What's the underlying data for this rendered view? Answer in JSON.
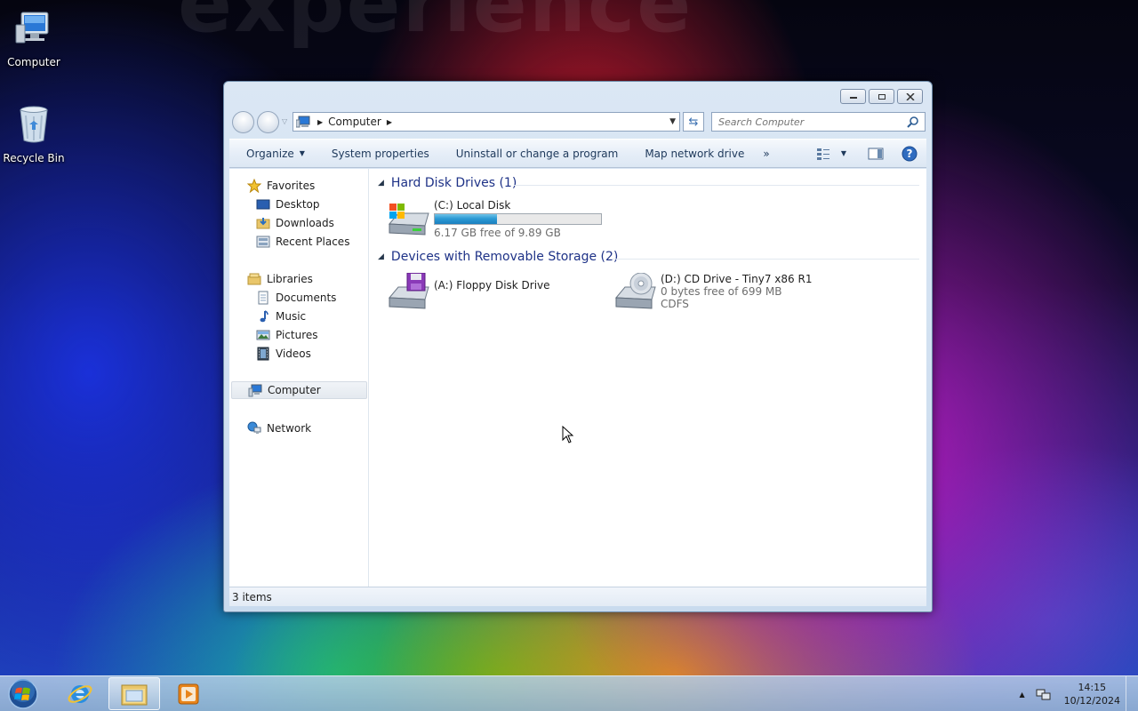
{
  "desktop": {
    "icons": [
      {
        "label": "Computer",
        "icon": "computer-icon"
      },
      {
        "label": "Recycle Bin",
        "icon": "recycle-bin-icon"
      }
    ]
  },
  "window": {
    "controls": [
      "minimize",
      "maximize",
      "close"
    ],
    "address": {
      "segments": [
        "Computer"
      ]
    },
    "search": {
      "placeholder": "Search Computer"
    },
    "toolbar": {
      "organize": "Organize",
      "system_properties": "System properties",
      "uninstall": "Uninstall or change a program",
      "map_network": "Map network drive",
      "more": "»"
    },
    "navpane": {
      "favorites": "Favorites",
      "desktop": "Desktop",
      "downloads": "Downloads",
      "recent_places": "Recent Places",
      "libraries": "Libraries",
      "documents": "Documents",
      "music": "Music",
      "pictures": "Pictures",
      "videos": "Videos",
      "computer": "Computer",
      "network": "Network"
    },
    "groups": {
      "hdd_header": "Hard Disk Drives (1)",
      "removable_header": "Devices with Removable Storage (2)"
    },
    "drives": {
      "c": {
        "name": "(C:) Local Disk",
        "free": "6.17 GB free of 9.89 GB",
        "used_fraction": 0.376
      },
      "a": {
        "name": "(A:) Floppy Disk Drive"
      },
      "d": {
        "name": "(D:) CD Drive - Tiny7 x86 R1",
        "free": "0 bytes free of 699 MB",
        "fs": "CDFS"
      }
    },
    "status": "3 items"
  },
  "taskbar": {
    "apps": [
      "internet-explorer",
      "windows-explorer",
      "media-player"
    ],
    "active_app": "windows-explorer",
    "clock": {
      "time": "14:15",
      "date": "10/12/2024"
    },
    "tray_arrow": "▲"
  },
  "colors": {
    "group_header": "#1e3287",
    "capacity_fill": "#2c9ad4"
  }
}
